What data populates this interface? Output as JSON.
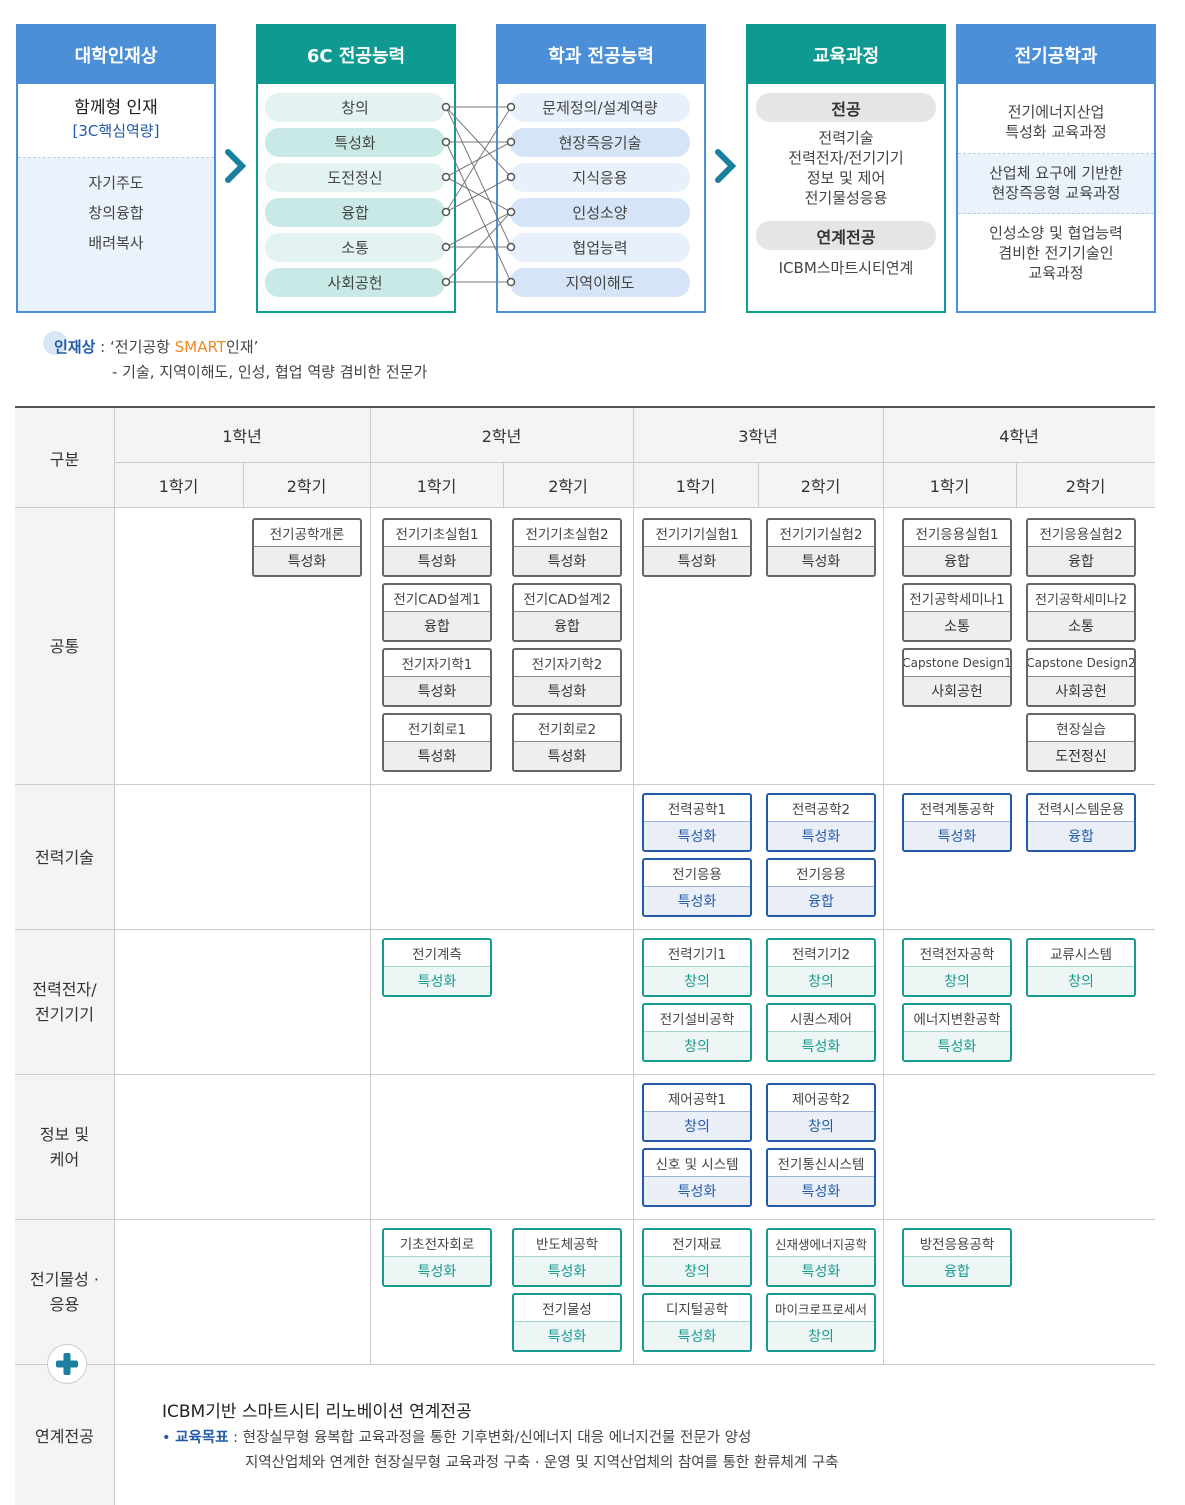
{
  "top": {
    "panel1": {
      "title": "대학인재상",
      "sub1": "함께형 인재",
      "sub2": "[3C핵심역량]",
      "items": [
        "자기주도",
        "창의융합",
        "배려복사"
      ]
    },
    "panel2": {
      "title": "6C 전공능력",
      "items": [
        "창의",
        "특성화",
        "도전정신",
        "융합",
        "소통",
        "사회공헌"
      ]
    },
    "panel3": {
      "title": "학과 전공능력",
      "items": [
        "문제정의/설계역량",
        "현장즉응기술",
        "지식응용",
        "인성소양",
        "협업능력",
        "지역이해도"
      ]
    },
    "panel4": {
      "title": "교육과정",
      "major_label": "전공",
      "major_items": [
        "전력기술",
        "전력전자/전기기기",
        "정보 및 제어",
        "전기물성응용"
      ],
      "linked_label": "연계전공",
      "linked_item": "ICBM스마트시티연계"
    },
    "panel5": {
      "title": "전기공학과",
      "blocks": [
        [
          "전기에너지산업",
          "특성화 교육과정"
        ],
        [
          "산업체 요구에 기반한",
          "현장즉응형 교육과정"
        ],
        [
          "인성소양 및 협업능력",
          "겸비한 전기기술인",
          "교육과정"
        ]
      ]
    }
  },
  "talent": {
    "label": "인재상",
    "colon": " : ",
    "q1": "‘전기공항 ",
    "smart": "SMART",
    "q2": "인재’",
    "line2": "- 기술, 지역이해도, 인성, 협업 역량 겸비한 전문가"
  },
  "colors": {
    "blue": "#4a8fd8",
    "teal": "#0e9a90",
    "dark_blue": "#235aa8",
    "orange": "#f08a24"
  },
  "table": {
    "header": {
      "category": "구분",
      "years": [
        "1학년",
        "2학년",
        "3학년",
        "4학년"
      ],
      "semesters": [
        "1학기",
        "2학기",
        "1학기",
        "2학기",
        "1학기",
        "2학기",
        "1학기",
        "2학기"
      ]
    },
    "rows": [
      "공통",
      "전력기술",
      "전력전자/\n전기기기",
      "정보 및\n케어",
      "전기물성 ·\n응용",
      "연계전공"
    ],
    "courses": {
      "c_1_2_1": [
        "전기공학개론",
        "특성화"
      ],
      "c_2_1_1": [
        "전기기초실험1",
        "특성화"
      ],
      "c_2_1_2": [
        "전기CAD설계1",
        "융합"
      ],
      "c_2_1_3": [
        "전기자기학1",
        "특성화"
      ],
      "c_2_1_4": [
        "전기회로1",
        "특성화"
      ],
      "c_2_2_1": [
        "전기기초실험2",
        "특성화"
      ],
      "c_2_2_2": [
        "전기CAD설계2",
        "융합"
      ],
      "c_2_2_3": [
        "전기자기학2",
        "특성화"
      ],
      "c_2_2_4": [
        "전기회로2",
        "특성화"
      ],
      "c_3_1_1": [
        "전기기기실험1",
        "특성화"
      ],
      "c_3_2_1": [
        "전기기기실험2",
        "특성화"
      ],
      "c_4_1_1": [
        "전기응용실험1",
        "융합"
      ],
      "c_4_1_2": [
        "전기공학세미나1",
        "소통"
      ],
      "c_4_1_3": [
        "Capstone Design1",
        "사회공헌"
      ],
      "c_4_2_1": [
        "전기응용실험2",
        "융합"
      ],
      "c_4_2_2": [
        "전기공학세미나2",
        "소통"
      ],
      "c_4_2_3": [
        "Capstone Design2",
        "사회공헌"
      ],
      "c_4_2_4": [
        "현장실습",
        "도전정신"
      ],
      "p_3_1_1": [
        "전력공학1",
        "특성화"
      ],
      "p_3_1_2": [
        "전기응용",
        "특성화"
      ],
      "p_3_2_1": [
        "전력공학2",
        "특성화"
      ],
      "p_3_2_2": [
        "전기응용",
        "융합"
      ],
      "p_4_1_1": [
        "전력계통공학",
        "특성화"
      ],
      "p_4_2_1": [
        "전력시스템운용",
        "융합"
      ],
      "e_2_1_1": [
        "전기계측",
        "특성화"
      ],
      "e_3_1_1": [
        "전력기기1",
        "창의"
      ],
      "e_3_1_2": [
        "전기설비공학",
        "창의"
      ],
      "e_3_2_1": [
        "전력기기2",
        "창의"
      ],
      "e_3_2_2": [
        "시퀀스제어",
        "특성화"
      ],
      "e_4_1_1": [
        "전력전자공학",
        "창의"
      ],
      "e_4_1_2": [
        "에너지변환공학",
        "특성화"
      ],
      "e_4_2_1": [
        "교류시스템",
        "창의"
      ],
      "i_3_1_1": [
        "제어공학1",
        "창의"
      ],
      "i_3_1_2": [
        "신호 및 시스템",
        "특성화"
      ],
      "i_3_2_1": [
        "제어공학2",
        "창의"
      ],
      "i_3_2_2": [
        "전기통신시스템",
        "특성화"
      ],
      "m_2_1_1": [
        "기초전자회로",
        "특성화"
      ],
      "m_2_2_1": [
        "반도체공학",
        "특성화"
      ],
      "m_2_2_2": [
        "전기물성",
        "특성화"
      ],
      "m_3_1_1": [
        "전기재료",
        "창의"
      ],
      "m_3_1_2": [
        "디지털공학",
        "특성화"
      ],
      "m_3_2_1": [
        "신재생에너지공학",
        "특성화"
      ],
      "m_3_2_2": [
        "마이크로프로세서",
        "창의"
      ],
      "m_4_1_1": [
        "방전응용공학",
        "융합"
      ]
    },
    "linked": {
      "title": "ICBM기반 스마트시티 리노베이션 연계전공",
      "bullet": "•",
      "goal_label": "교육목표",
      "goal_colon": " : ",
      "goal1": "현장실무형 융복합 교육과정을 통한 기후변화/신에너지 대응 에너지건물 전문가 양성",
      "goal2": "지역산업체와 연계한 현장실무형 교육과정 구축 · 운영 및 지역산업체의 참여를 통한 환류체계 구축"
    }
  }
}
